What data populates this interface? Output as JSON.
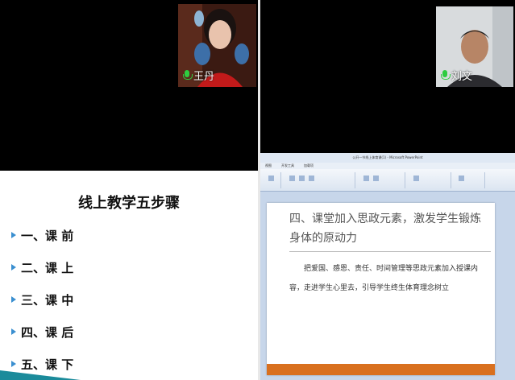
{
  "participants": [
    {
      "name": "王丹"
    },
    {
      "name": "刘文"
    }
  ],
  "left_slide": {
    "title": "线上教学五步骤",
    "steps": [
      "一、课  前",
      "二、课  上",
      "三、课  中",
      "四、课  后",
      "五、课  下"
    ]
  },
  "ppt": {
    "window_title": "公开一节线上体育课(1) - Microsoft PowerPoint",
    "tabs": [
      "视图",
      "开发工具",
      "加载项"
    ],
    "heading": "四、课堂加入思政元素，激发学生锻炼身体的原动力",
    "body": "把爱国、感恩、责任、时间管理等思政元素加入授课内容，走进学生心里去，引导学生终生体育理念树立"
  },
  "colors": {
    "accent_teal": "#1b8b9b",
    "bullet_blue": "#3a8fd0",
    "mic_green": "#2ecc40",
    "ppt_footer_orange": "#d9701f"
  }
}
